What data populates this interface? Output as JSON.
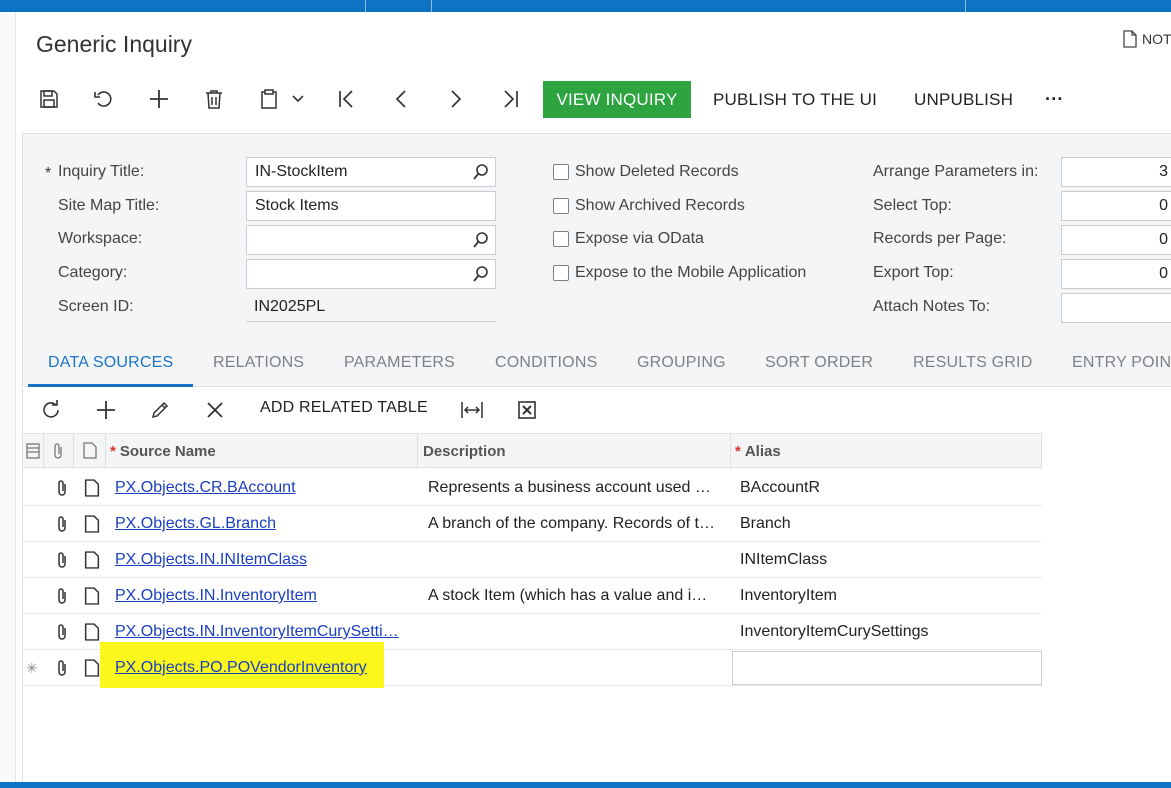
{
  "page": {
    "title": "Generic Inquiry",
    "notes_label": "NOT"
  },
  "toolbar": {
    "icons": [
      "save-icon",
      "undo-icon",
      "add-icon",
      "delete-icon",
      "clipboard-icon",
      "chevron-down-icon",
      "first-record-icon",
      "previous-icon",
      "next-icon",
      "last-record-icon"
    ],
    "view_inquiry": "VIEW INQUIRY",
    "publish": "PUBLISH TO THE UI",
    "unpublish": "UNPUBLISH",
    "more": "···",
    "accent_color": "#2da43f"
  },
  "form": {
    "inquiry_title": {
      "label": "Inquiry Title:",
      "required_mark": "*",
      "value": "IN-StockItem"
    },
    "site_map_title": {
      "label": "Site Map Title:",
      "value": "Stock Items"
    },
    "workspace": {
      "label": "Workspace:",
      "value": ""
    },
    "category": {
      "label": "Category:",
      "value": ""
    },
    "screen_id": {
      "label": "Screen ID:",
      "value": "IN2025PL"
    },
    "checkboxes": [
      {
        "label": "Show Deleted Records",
        "checked": false
      },
      {
        "label": "Show Archived Records",
        "checked": false
      },
      {
        "label": "Expose via OData",
        "checked": false
      },
      {
        "label": "Expose to the Mobile Application",
        "checked": false
      }
    ],
    "arrange_parameters": {
      "label": "Arrange Parameters in:",
      "value": "3"
    },
    "select_top": {
      "label": "Select Top:",
      "value": "0"
    },
    "records_per_page": {
      "label": "Records per Page:",
      "value": "0"
    },
    "export_top": {
      "label": "Export Top:",
      "value": "0"
    },
    "attach_notes_to": {
      "label": "Attach Notes To:",
      "value": ""
    }
  },
  "tabs": [
    {
      "label": "DATA SOURCES",
      "active": true
    },
    {
      "label": "RELATIONS",
      "active": false
    },
    {
      "label": "PARAMETERS",
      "active": false
    },
    {
      "label": "CONDITIONS",
      "active": false
    },
    {
      "label": "GROUPING",
      "active": false
    },
    {
      "label": "SORT ORDER",
      "active": false
    },
    {
      "label": "RESULTS GRID",
      "active": false
    },
    {
      "label": "ENTRY POIN",
      "active": false
    }
  ],
  "grid_toolbar": {
    "icons": [
      "refresh-icon",
      "add-icon",
      "edit-icon",
      "delete-icon"
    ],
    "add_related_table": "ADD RELATED TABLE",
    "fit_icon": "fit-to-screen-icon",
    "excel_icon": "excel-export-icon"
  },
  "grid": {
    "columns": [
      {
        "label": "Source Name",
        "required": true
      },
      {
        "label": "Description",
        "required": false
      },
      {
        "label": "Alias",
        "required": true
      }
    ],
    "required_mark": "*",
    "new_row_marker": "✳",
    "rows": [
      {
        "source": "PX.Objects.CR.BAccount",
        "description": "Represents a business account used …",
        "alias": "BAccountR"
      },
      {
        "source": "PX.Objects.GL.Branch",
        "description": "A branch of the company. Records of t…",
        "alias": "Branch"
      },
      {
        "source": "PX.Objects.IN.INItemClass",
        "description": "",
        "alias": "INItemClass"
      },
      {
        "source": "PX.Objects.IN.InventoryItem",
        "description": "A stock Item (which has a value and i…",
        "alias": "InventoryItem"
      },
      {
        "source": "PX.Objects.IN.InventoryItemCurySetti…",
        "description": "",
        "alias": "InventoryItemCurySettings"
      },
      {
        "source": "PX.Objects.PO.POVendorInventory",
        "description": "",
        "alias": "",
        "new": true,
        "highlighted": true
      }
    ],
    "highlight_color": "#fbf71c",
    "link_color": "#1a3fbf"
  }
}
